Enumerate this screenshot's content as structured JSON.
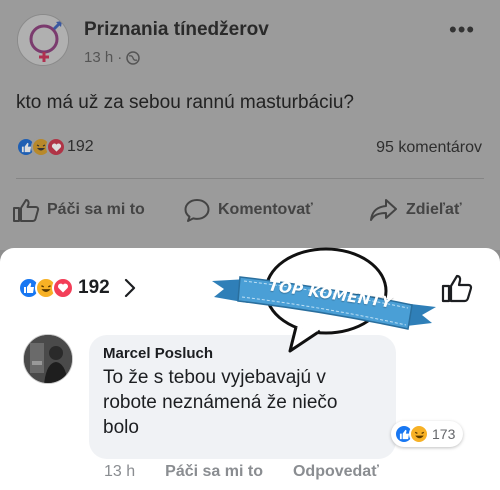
{
  "post": {
    "page_name": "Priznania tínedžerov",
    "time": "13 h",
    "separator": "·",
    "avatar_logo_text": "Priznania tínedžerov",
    "text": "kto má už za sebou rannú masturbáciu?",
    "reaction_count": "192",
    "comment_count": "95 komentárov",
    "actions": {
      "like": "Páči sa mi to",
      "comment": "Komentovať",
      "share": "Zdieľať"
    }
  },
  "sheet": {
    "reaction_count": "192",
    "sticker_text": "TOP KOMENTY"
  },
  "comment": {
    "author": "Marcel Posluch",
    "text": "To že s tebou vyjebavajú v robote neznámená že niečo bolo",
    "reaction_count": "173",
    "time": "13 h",
    "like_label": "Páči sa mi to",
    "reply_label": "Odpovedať"
  },
  "icons": [
    "globe-icon",
    "more-icon",
    "like-reaction-icon",
    "haha-reaction-icon",
    "love-reaction-icon",
    "thumbs-up-outline-icon",
    "comment-outline-icon",
    "share-arrow-icon",
    "chevron-right-icon"
  ],
  "colors": {
    "like_blue": "#1877f2",
    "love_red": "#f33e58",
    "haha_yellow": "#f7b125",
    "ribbon_blue": "#4a9fd6",
    "dim_overlay": "#9b9b9b"
  }
}
